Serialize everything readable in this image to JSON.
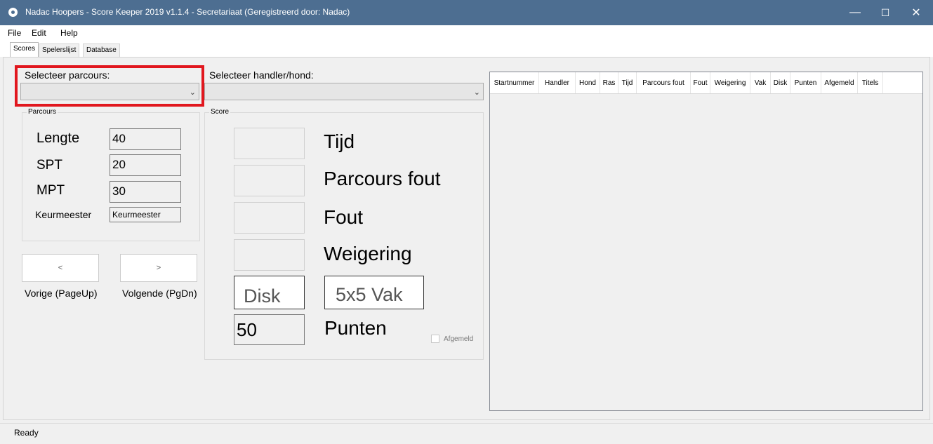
{
  "window": {
    "title": "Nadac Hoopers - Score Keeper 2019 v1.1.4 - Secretariaat  (Geregistreerd door: Nadac)",
    "minimize": "—",
    "maximize": "☐",
    "close": "✕"
  },
  "menu": [
    "File",
    "Edit",
    "Help"
  ],
  "tabs": [
    "Scores",
    "Spelerslijst",
    "Database"
  ],
  "select_parcours": {
    "label": "Selecteer parcours:",
    "value": ""
  },
  "select_handler": {
    "label": "Selecteer handler/hond:",
    "value": ""
  },
  "parcours_group": {
    "title": "Parcours",
    "lengte_label": "Lengte",
    "lengte_value": "40",
    "spt_label": "SPT",
    "spt_value": "20",
    "mpt_label": "MPT",
    "mpt_value": "30",
    "keurmeester_label": "Keurmeester",
    "keurmeester_value": "Keurmeester"
  },
  "nav": {
    "prev_symbol": "<",
    "next_symbol": ">",
    "prev_label": "Vorige (PageUp)",
    "next_label": "Volgende (PgDn)"
  },
  "score_group": {
    "title": "Score",
    "tijd": "Tijd",
    "parcours_fout": "Parcours fout",
    "fout": "Fout",
    "weigering": "Weigering",
    "disk": "Disk",
    "vak": "5x5 Vak",
    "punten_value": "50",
    "punten_label": "Punten",
    "afgemeld": "Afgemeld"
  },
  "grid_columns": [
    "Startnummer",
    "Handler",
    "Hond",
    "Ras",
    "Tijd",
    "Parcours fout",
    "Fout",
    "Weigering",
    "Vak",
    "Disk",
    "Punten",
    "Afgemeld",
    "Titels"
  ],
  "status": {
    "text": "Ready",
    "grip": ".::"
  },
  "colors": {
    "titlebar": "#4d6e91",
    "highlight": "#e1171e"
  }
}
